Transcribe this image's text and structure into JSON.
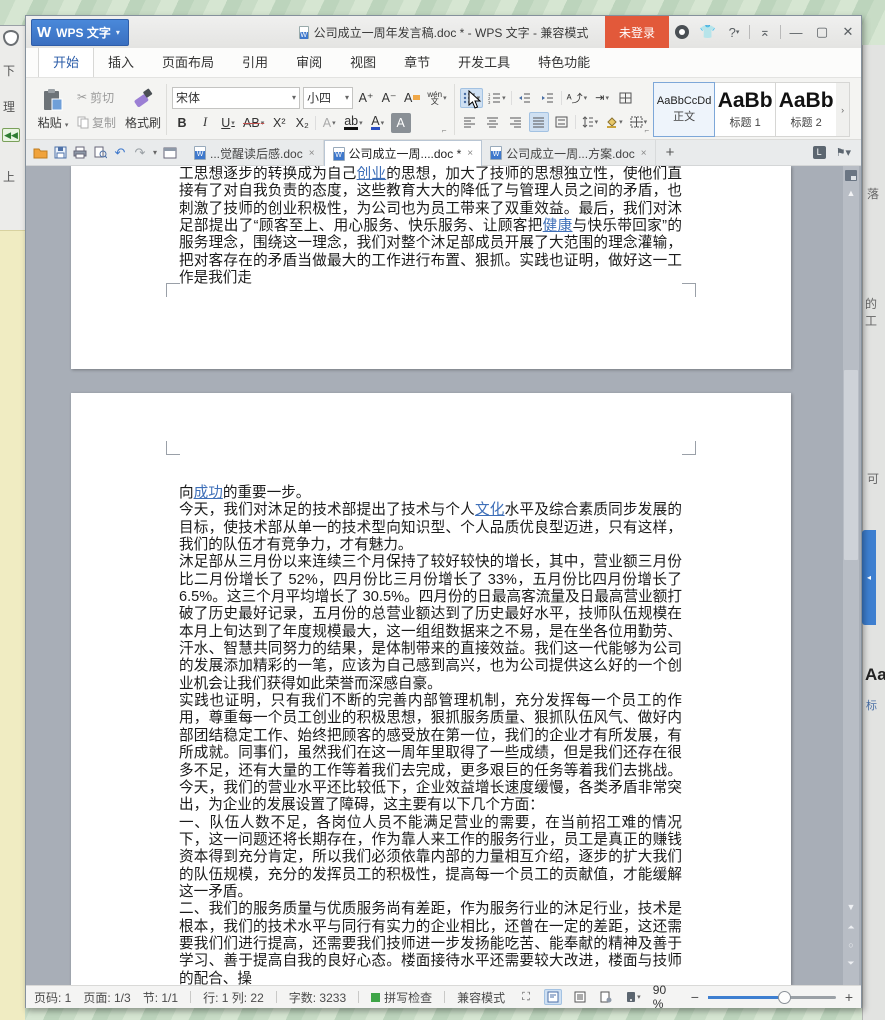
{
  "window": {
    "app_button": "WPS 文字",
    "app_button_caret": "▾",
    "title": "公司成立一周年发言稿.doc * - WPS 文字 - 兼容模式",
    "login_button": "未登录",
    "help_label": "?",
    "minimize_glyph": "—",
    "maximize_glyph": "▢",
    "close_glyph": "✕"
  },
  "menu": {
    "tabs": [
      {
        "label": "开始",
        "active": true
      },
      {
        "label": "插入",
        "active": false
      },
      {
        "label": "页面布局",
        "active": false
      },
      {
        "label": "引用",
        "active": false
      },
      {
        "label": "审阅",
        "active": false
      },
      {
        "label": "视图",
        "active": false
      },
      {
        "label": "章节",
        "active": false
      },
      {
        "label": "开发工具",
        "active": false
      },
      {
        "label": "特色功能",
        "active": false
      }
    ]
  },
  "ribbon": {
    "paste_label": "粘贴",
    "cut_label": "剪切",
    "copy_label": "复制",
    "format_painter_label": "格式刷",
    "font_name": "宋体",
    "font_size": "小四",
    "grow_font": "A⁺",
    "shrink_font": "A⁻",
    "clear_format": "A",
    "phonetic_top": "wén",
    "phonetic_bottom": "文",
    "bold": "B",
    "italic": "I",
    "underline": "U",
    "strike": "AB",
    "superscript": "X²",
    "subscript": "X₂",
    "outline_a": "A",
    "highlight_a": "ab",
    "color_a": "A",
    "shade_a": "A",
    "styles": [
      {
        "sample": "AaBbCcDd",
        "label": "正文",
        "selected": true,
        "large": false
      },
      {
        "sample": "AaBb",
        "label": "标题 1",
        "selected": false,
        "large": true
      },
      {
        "sample": "AaBb",
        "label": "标题 2",
        "selected": false,
        "large": true
      }
    ],
    "styles_scroll": "›"
  },
  "tabbar": {
    "documents": [
      {
        "label": "...觉醒读后感.doc",
        "close": "×",
        "active": false
      },
      {
        "label": "公司成立一周....doc *",
        "close": "×",
        "active": true
      },
      {
        "label": "公司成立一周...方案.doc",
        "close": "×",
        "active": false
      }
    ],
    "new_tab": "+"
  },
  "document": {
    "page1_paragraphs": [
      [
        {
          "t": "工思想逐步的转换成为自己"
        },
        {
          "t": "创业",
          "link": true
        },
        {
          "t": "的思想，加大了技师的思想独立性，使他们直接有了对自我负责的态度，这些教育大大的降低了与管理人员之间的矛盾，也刺激了技师的创业积极性，为公司也为员工带来了双重效益。最后，我们对沐足部提出了“顾客至上、用心服务、快乐服务、让顾客把"
        },
        {
          "t": "健康",
          "link": true
        },
        {
          "t": "与快乐带回家”的服务理念，围绕这一理念，我们对整个沐足部成员开展了大范围的理念灌输，把对客存在的矛盾当做最大的工作进行布置、狠抓。实践也证明，做好这一工作是我们走"
        }
      ]
    ],
    "page2_paragraphs": [
      [
        {
          "t": "向"
        },
        {
          "t": "成功",
          "link": true
        },
        {
          "t": "的重要一步。"
        }
      ],
      [
        {
          "t": "今天，我们对沐足的技术部提出了技术与个人"
        },
        {
          "t": "文化",
          "link": true
        },
        {
          "t": "水平及综合素质同步发展的目标，使技术部从单一的技术型向知识型、个人品质优良型迈进，只有这样，我们的队伍才有竞争力，才有魅力。"
        }
      ],
      [
        {
          "t": "沐足部从三月份以来连续三个月保持了较好较快的增长，其中，营业额三月份比二月份增长了 52%，四月份比三月份增长了 33%，五月份比四月份增长了 6.5%。这三个月平均增长了 30.5%。四月份的日最高客流量及日最高营业额打破了历史最好记录，五月份的总营业额达到了历史最好水平，技师队伍规模在本月上旬达到了年度规模最大，这一组组数据来之不易，是在坐各位用勤劳、汗水、智慧共同努力的结果，是体制带来的直接效益。我们这一代能够为公司的发展添加精彩的一笔，应该为自己感到高兴，也为公司提供这么好的一个创业机会让我们获得如此荣誉而深感自豪。"
        }
      ],
      [
        {
          "t": "实践也证明，只有我们不断的完善内部管理机制，充分发挥每一个员工的作用，尊重每一个员工创业的积极思想，狠抓服务质量、狠抓队伍风气、做好内部团结稳定工作、始终把顾客的感受放在第一位，我们的企业才有所发展，有所成就。同事们，虽然我们在这一周年里取得了一些成绩，但是我们还存在很多不足，还有大量的工作等着我们去完成，更多艰巨的任务等着我们去挑战。今天，我们的营业水平还比较低下，企业效益增长速度缓慢，各类矛盾非常突出，为企业的发展设置了障碍，这主要有以下几个方面："
        }
      ],
      [
        {
          "t": "一、队伍人数不足，各岗位人员不能满足营业的需要，在当前招工难的情况下，这一问题还将长期存在，作为靠人来工作的服务行业，员工是真正的赚钱资本得到充分肯定，所以我们必须依靠内部的力量相互介绍，逐步的扩大我们的队伍规模，充分的发挥员工的积极性，提高每一个员工的贡献值，才能缓解这一矛盾。"
        }
      ],
      [
        {
          "t": "二、我们的服务质量与优质服务尚有差距，作为服务行业的沐足行业，技术是根本，我们的技术水平与同行有实力的企业相比，还曾在一定的差距，这还需要我们们进行提高，还需要我们技师进一步发扬能吃苦、能奉献的精神及善于学习、善于提高自我的良好心态。楼面接待水平还需要较大改进，楼面与技师的配合、操"
        }
      ]
    ]
  },
  "status_bar": {
    "items": [
      {
        "t": "页码: 1"
      },
      {
        "t": "页面: 1/3"
      },
      {
        "t": "节: 1/1",
        "sep": true
      },
      {
        "t": "行: 1  列: 22",
        "sep": true
      },
      {
        "t": "字数: 3233",
        "sep": true
      },
      {
        "t": "拼写检查",
        "square": true,
        "sep": true
      },
      {
        "t": "兼容模式"
      }
    ],
    "zoom_percent": "90 %",
    "zoom_minus": "−",
    "zoom_plus": "+"
  },
  "background": {
    "left_fragments": [
      "下",
      "理",
      "上"
    ],
    "right_fragments": [
      "落",
      "的工",
      "可",
      "Aa",
      "标"
    ]
  },
  "colors": {
    "app_blue": "#3e78cc",
    "login_orange": "#e2593a",
    "link_blue": "#3e6fb8",
    "selection_highlight": "#cfe0f2",
    "doc_background": "#a8aeb7",
    "spellcheck_green": "#3fa548",
    "format_painter_purple": "#9b7fd4"
  }
}
